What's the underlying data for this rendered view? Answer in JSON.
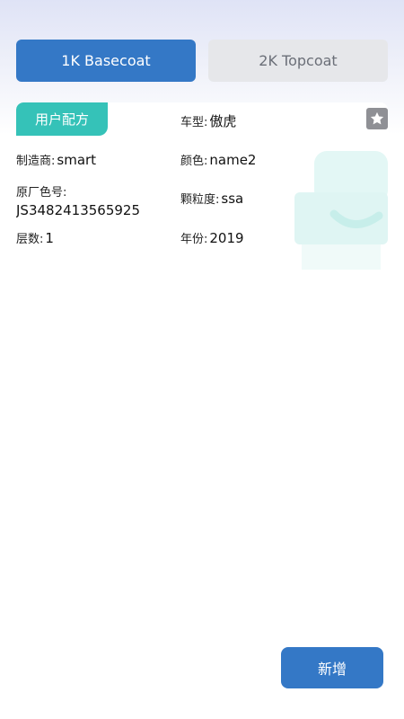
{
  "tabs": [
    {
      "label": "1K Basecoat",
      "active": true
    },
    {
      "label": "2K Topcoat",
      "active": false
    }
  ],
  "card": {
    "badge": "用户配方",
    "car_type_label": "车型:",
    "car_type_value": "傲虎",
    "maker_label": "制造商:",
    "maker_value": "smart",
    "color_label": "颜色:",
    "color_value": "name2",
    "oem_code_label": "原厂色号:",
    "oem_code_value": "JS3482413565925",
    "grain_label": "颗粒度:",
    "grain_value": "ssa",
    "layers_label": "层数:",
    "layers_value": "1",
    "year_label": "年份:",
    "year_value": "2019",
    "favorite_icon": "star-icon"
  },
  "actions": {
    "add_label": "新增"
  },
  "colors": {
    "primary": "#3478c6",
    "teal": "#35c2b8",
    "inactive_bg": "#e6e7ea",
    "inactive_text": "#6b6f78"
  }
}
